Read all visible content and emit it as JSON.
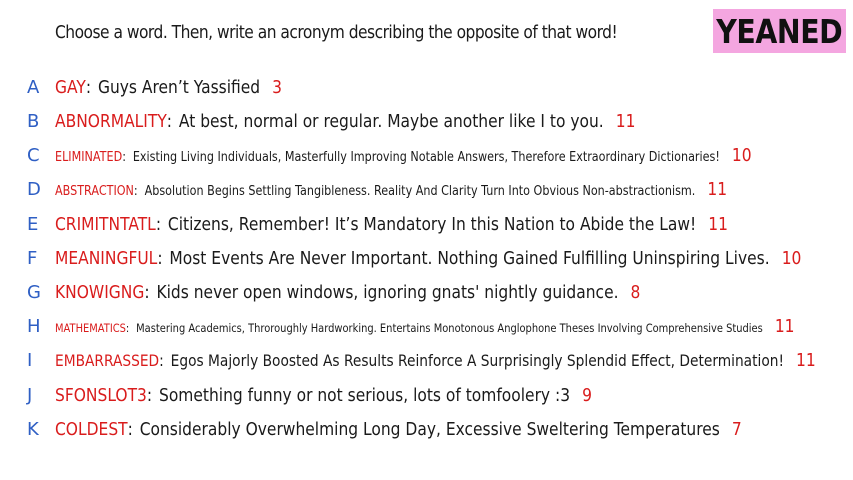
{
  "prompt": "Choose a word. Then, write an acronym describing the opposite of that word!",
  "room_code": "YEANED",
  "entries": [
    {
      "letter": "A",
      "word": "GAY",
      "acronym": "Guys Aren’t Yassified",
      "score": "3"
    },
    {
      "letter": "B",
      "word": "ABNORMALITY",
      "acronym": "At best, normal or regular. Maybe another like I to you.",
      "score": "11"
    },
    {
      "letter": "C",
      "word": "ELIMINATED",
      "acronym": "Existing Living Individuals, Masterfully Improving Notable Answers, Therefore Extraordinary Dictionaries!",
      "score": "10"
    },
    {
      "letter": "D",
      "word": "ABSTRACTION",
      "acronym": "Absolution Begins Settling Tangibleness. Reality And Clarity Turn Into Obvious Non-abstractionism.",
      "score": "11"
    },
    {
      "letter": "E",
      "word": "CRIMITNTATL",
      "acronym": "Citizens, Remember! It’s Mandatory In this Nation to Abide the Law!",
      "score": "11"
    },
    {
      "letter": "F",
      "word": "MEANINGFUL",
      "acronym": "Most Events Are Never Important. Nothing Gained Fulfilling Uninspiring Lives.",
      "score": "10"
    },
    {
      "letter": "G",
      "word": "KNOWIGNG",
      "acronym": "Kids never open windows, ignoring gnats' nightly guidance.",
      "score": "8"
    },
    {
      "letter": "H",
      "word": "MATHEMATICS",
      "acronym": "Mastering Academics, Throroughly Hardworking. Entertains Monotonous Anglophone Theses Involving Comprehensive Studies",
      "score": "11"
    },
    {
      "letter": "I",
      "word": "EMBARRASSED",
      "acronym": "Egos Majorly Boosted As Results Reinforce A Surprisingly Splendid Effect, Determination!",
      "score": "11"
    },
    {
      "letter": "J",
      "word": "SFONSLOT3",
      "acronym": "Something funny or not serious, lots of tomfoolery :3",
      "score": "9"
    },
    {
      "letter": "K",
      "word": "COLDEST",
      "acronym": "Considerably Overwhelming Long Day, Excessive Sweltering Temperatures",
      "score": "7"
    }
  ]
}
